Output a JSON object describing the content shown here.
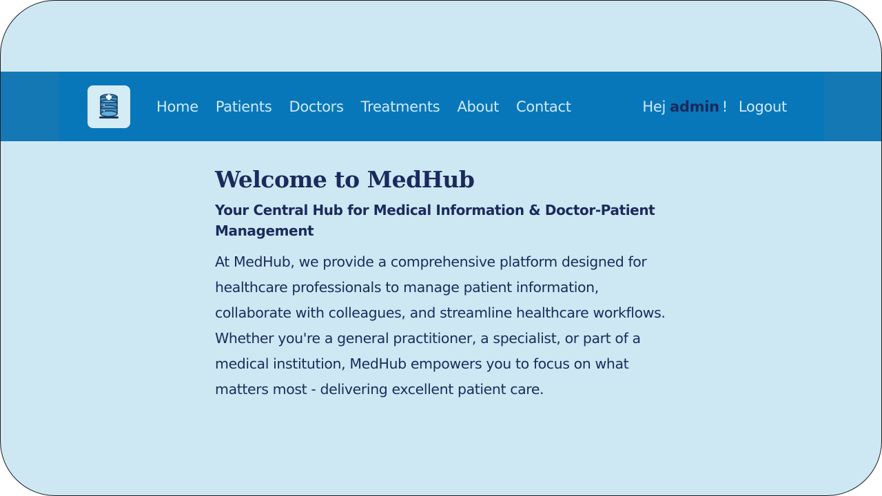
{
  "app": {
    "brand_color": "#0877b9",
    "background_color": "#cde8f3",
    "text_color": "#1b2a5c",
    "logo_icon": "database-medical-icon"
  },
  "nav": {
    "items": [
      {
        "label": "Home"
      },
      {
        "label": "Patients"
      },
      {
        "label": "Doctors"
      },
      {
        "label": "Treatments"
      },
      {
        "label": "About"
      },
      {
        "label": "Contact"
      }
    ],
    "greeting": "Hej",
    "username": "admin",
    "exclaim": "!",
    "logout_label": "Logout"
  },
  "main": {
    "title": "Welcome to MedHub",
    "subtitle": "Your Central Hub for Medical Information & Doctor-Patient Management",
    "intro": "At MedHub, we provide a comprehensive platform designed for healthcare professionals to manage patient information, collaborate with colleagues, and streamline healthcare workflows. Whether you're a general practitioner, a specialist, or part of a medical institution, MedHub empowers you to focus on what matters most - delivering excellent patient care."
  }
}
